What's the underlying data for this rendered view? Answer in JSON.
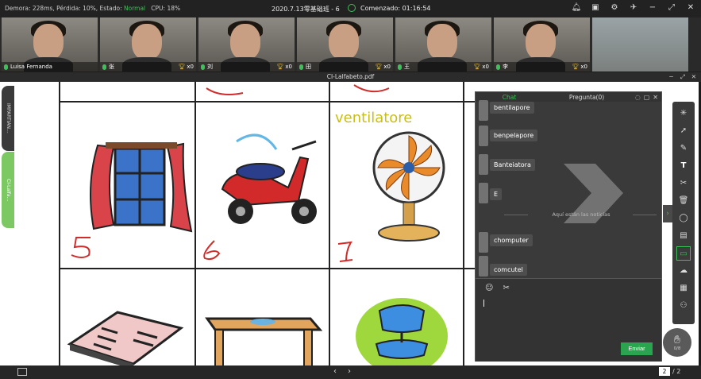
{
  "topbar": {
    "stats_prefix": "Demora: 228ms, Pérdida: 10%, Estado:",
    "status": "Normal",
    "cpu": "CPU: 18%",
    "title": "2020.7.13零基础班 - 6",
    "started": "Comenzado: 01:16:54"
  },
  "participants": [
    {
      "name": "Luisa Fernanda",
      "score": "",
      "has_video": true
    },
    {
      "name": "张",
      "score": "x0",
      "has_video": true
    },
    {
      "name": "刘",
      "score": "x0",
      "has_video": true
    },
    {
      "name": "田",
      "score": "x0",
      "has_video": true
    },
    {
      "name": "王",
      "score": "x0",
      "has_video": true
    },
    {
      "name": "李",
      "score": "x0",
      "has_video": true
    }
  ],
  "document": {
    "filename": "CI-Lalfabeto.pdf",
    "left_tab_1": "IMPARTIAN...",
    "left_tab_2": "CI-Lalfa...",
    "word": "ventilatore",
    "handwritten_numbers": [
      "5",
      "6",
      "7"
    ]
  },
  "chat": {
    "tab_chat": "Chat",
    "tab_question": "Pregunta(0)",
    "messages": [
      "bentilapore",
      "benpelapore",
      "Banteiatora",
      "E",
      "chomputer",
      "comcutel"
    ],
    "notice": "Aquí están las noticias",
    "send": "Enviar"
  },
  "pagination": {
    "current": "2",
    "total": "/ 2"
  },
  "hand": {
    "count": "0/8"
  },
  "colors": {
    "accent": "#3fbf5a",
    "send": "#2aa44f",
    "word": "#c9bf14",
    "ink": "#d12c2c"
  },
  "icons": [
    "bell-icon",
    "screen-share-icon",
    "gear-icon",
    "pin-icon",
    "minimize-icon",
    "fullscreen-icon",
    "close-icon",
    "emoji-icon",
    "scissors-icon",
    "laser-pointer-icon",
    "select-icon",
    "pen-icon",
    "text-icon",
    "cut-icon",
    "trash-icon",
    "shape-icon",
    "page-icon",
    "chat-icon",
    "cloud-icon",
    "toolbox-icon",
    "users-icon",
    "hand-icon"
  ]
}
